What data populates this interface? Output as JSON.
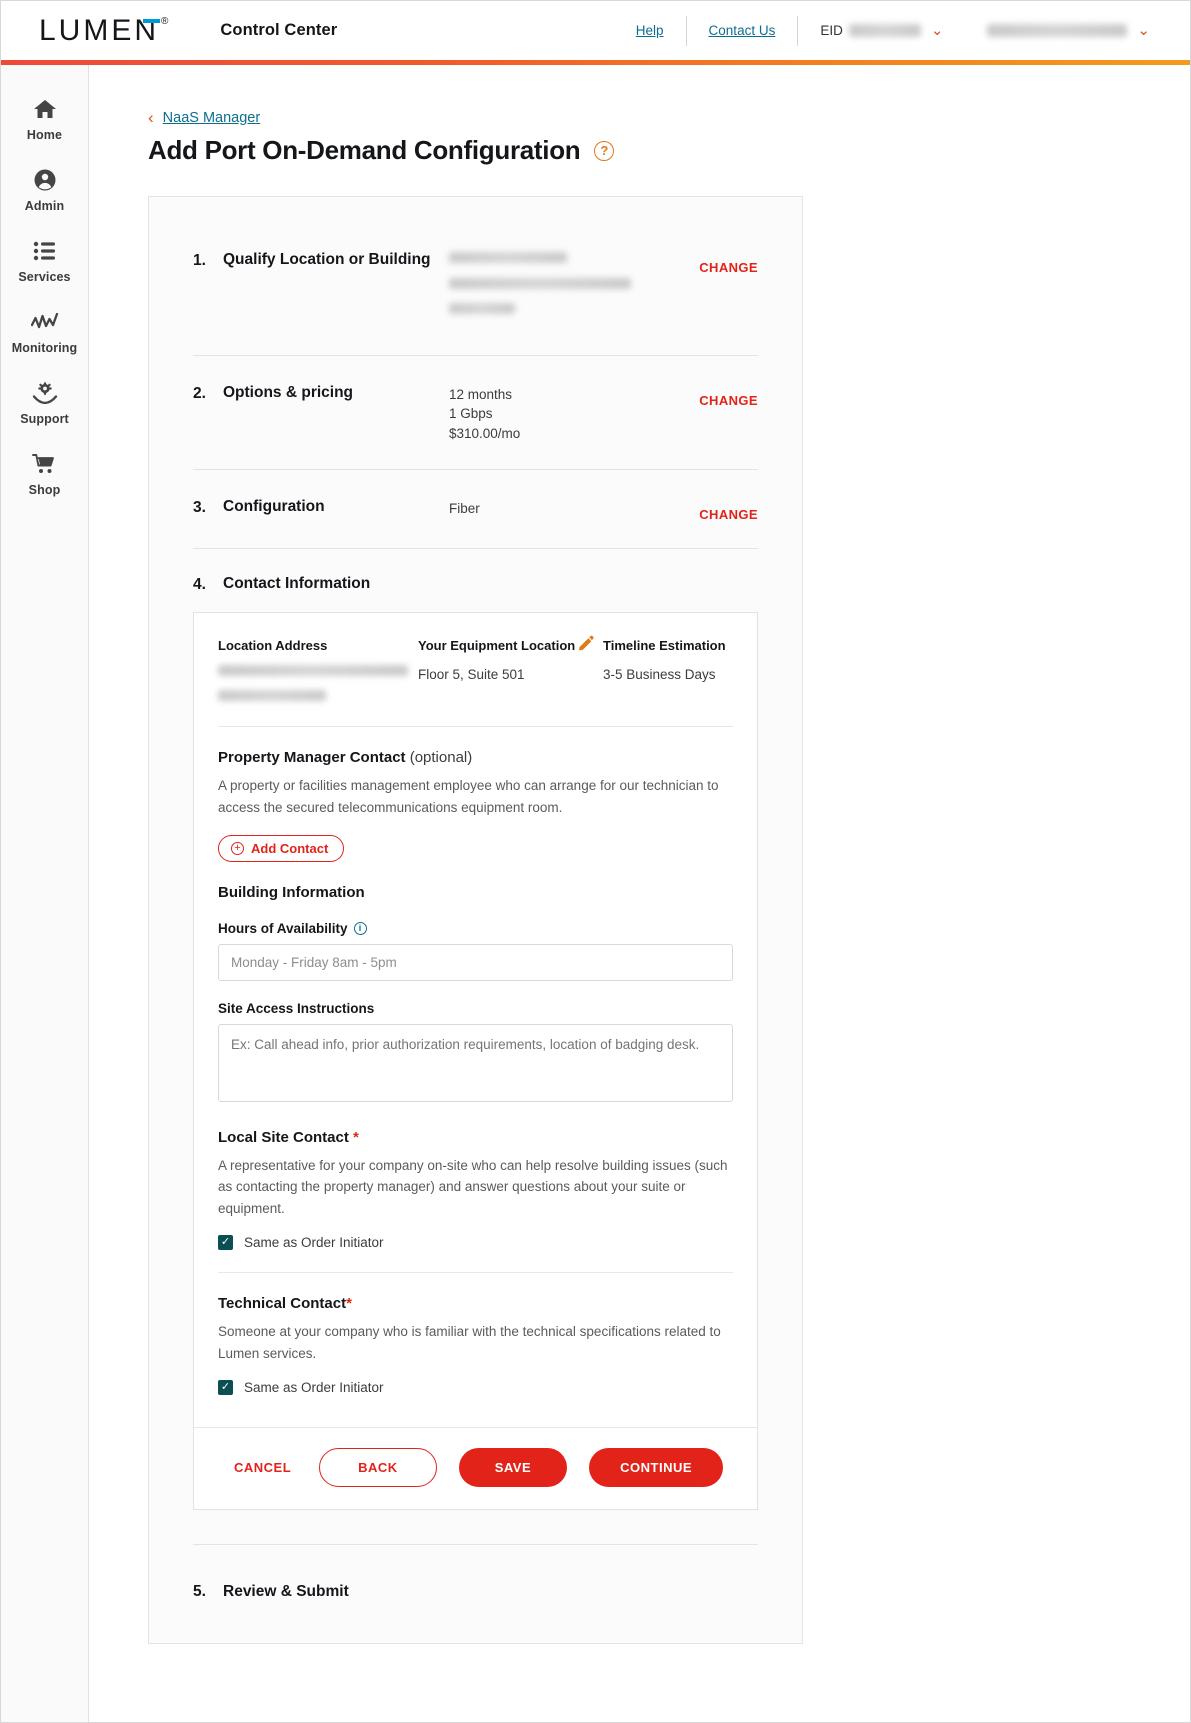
{
  "topbar": {
    "brand": "LUMEN",
    "brand_reg": "®",
    "app_title": "Control Center",
    "help_label": "Help",
    "contact_label": "Contact Us",
    "eid_label": "EID",
    "accent_colors": [
      "#ee4a3a",
      "#f59a1e"
    ]
  },
  "sidebar": {
    "items": [
      {
        "label": "Home",
        "icon": "home-icon"
      },
      {
        "label": "Admin",
        "icon": "user-circle-icon"
      },
      {
        "label": "Services",
        "icon": "list-icon"
      },
      {
        "label": "Monitoring",
        "icon": "activity-icon"
      },
      {
        "label": "Support",
        "icon": "gear-hand-icon"
      },
      {
        "label": "Shop",
        "icon": "cart-icon"
      }
    ]
  },
  "breadcrumb": {
    "back_icon": "chevron-left-icon",
    "link_label": "NaaS Manager"
  },
  "page": {
    "title": "Add Port On-Demand Configuration",
    "help_icon": "question-mark-icon"
  },
  "steps": [
    {
      "number": "1.",
      "name": "Qualify Location or Building",
      "detail_redacted": true,
      "detail_lines": [],
      "change_label": "CHANGE"
    },
    {
      "number": "2.",
      "name": "Options & pricing",
      "detail_redacted": false,
      "detail_lines": [
        "12 months",
        "1 Gbps",
        "$310.00/mo"
      ],
      "change_label": "CHANGE"
    },
    {
      "number": "3.",
      "name": "Configuration",
      "detail_redacted": false,
      "detail_lines": [
        "Fiber"
      ],
      "change_label": "CHANGE"
    }
  ],
  "step4": {
    "number": "4.",
    "name": "Contact Information",
    "address": {
      "location_label": "Location Address",
      "location_redacted": true,
      "equipment_label": "Your Equipment Location",
      "equipment_value": "Floor 5, Suite 501",
      "edit_icon": "pencil-icon",
      "timeline_label": "Timeline Estimation",
      "timeline_value": "3-5 Business Days"
    },
    "property_manager": {
      "title": "Property Manager Contact",
      "optional_suffix": " (optional)",
      "description": "A property or facilities management employee who can arrange for our technician to access the secured telecommunications equipment room.",
      "add_button_label": "Add Contact",
      "add_button_icon": "plus-circle-icon"
    },
    "building_information": {
      "title": "Building Information",
      "hours_label": "Hours of Availability",
      "hours_info_icon": "info-icon",
      "hours_value": "Monday - Friday 8am - 5pm",
      "site_access_label": "Site Access Instructions",
      "site_access_placeholder": "Ex: Call ahead info, prior authorization requirements, location of badging desk."
    },
    "local_site_contact": {
      "title": "Local Site Contact",
      "required_marker": "*",
      "description": "A representative for your company on-site who can help resolve building issues (such as contacting the property manager) and answer questions about your suite or equipment.",
      "checkbox_label": "Same as Order Initiator",
      "checkbox_checked": true,
      "checkbox_color": "#0b4f52"
    },
    "technical_contact": {
      "title": "Technical Contact",
      "required_marker": "*",
      "description": "Someone at your company who is familiar with the technical specifications related to Lumen services.",
      "checkbox_label": "Same as Order Initiator",
      "checkbox_checked": true,
      "checkbox_color": "#0b4f52"
    },
    "actions": {
      "cancel_label": "CANCEL",
      "back_label": "BACK",
      "save_label": "SAVE",
      "continue_label": "CONTINUE",
      "primary_color": "#e2231a"
    }
  },
  "step5": {
    "number": "5.",
    "name": "Review & Submit"
  }
}
